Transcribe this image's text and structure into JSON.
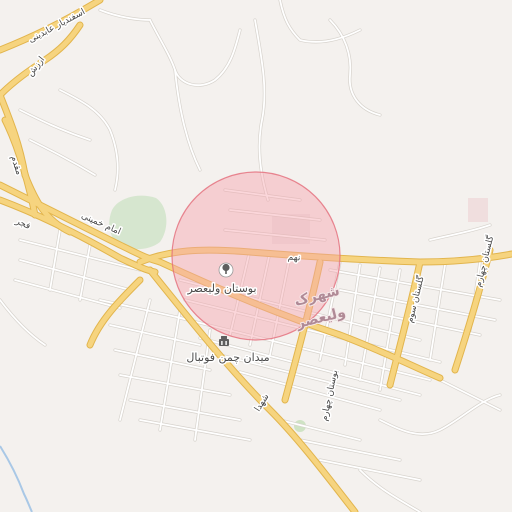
{
  "map": {
    "colors": {
      "land": "#f4f1ee",
      "minor_road": "#ffffff",
      "minor_road_casing": "#d7d3cd",
      "major_road": "#f6d47f",
      "major_road_casing": "#e2b54d",
      "park": "#d6e6cf",
      "residential": "#f0dede",
      "highlight_fill": "#f6a5ad",
      "highlight_stroke": "#e46b79",
      "river": "#a9c8e6"
    },
    "highlight": {
      "shape": "circle",
      "opacity": 0.45
    },
    "labels": {
      "street_esfandiar": "اسفندیار عابدینی",
      "street_arzesh": "ارزش",
      "street_moghaddam": "مقدم",
      "street_fajr": "فجر",
      "street_imam_khomeini": "امام خمینی",
      "street_nahom": "نهم",
      "street_golestan_sevom": "گلستان سوم",
      "street_golestan_chaharom": "گلستان چهارم",
      "street_bustan_chaharom": "بوستان چهارم",
      "street_shohada": "شهدا",
      "district_name_1": "شهرک",
      "district_name_2": "ولیعصر",
      "poi_park": "بوستان ولیعصر",
      "poi_stadium": "میدان چمن فوتبال"
    },
    "icons": {
      "park": "tree-icon",
      "stadium": "stadium-icon"
    }
  }
}
